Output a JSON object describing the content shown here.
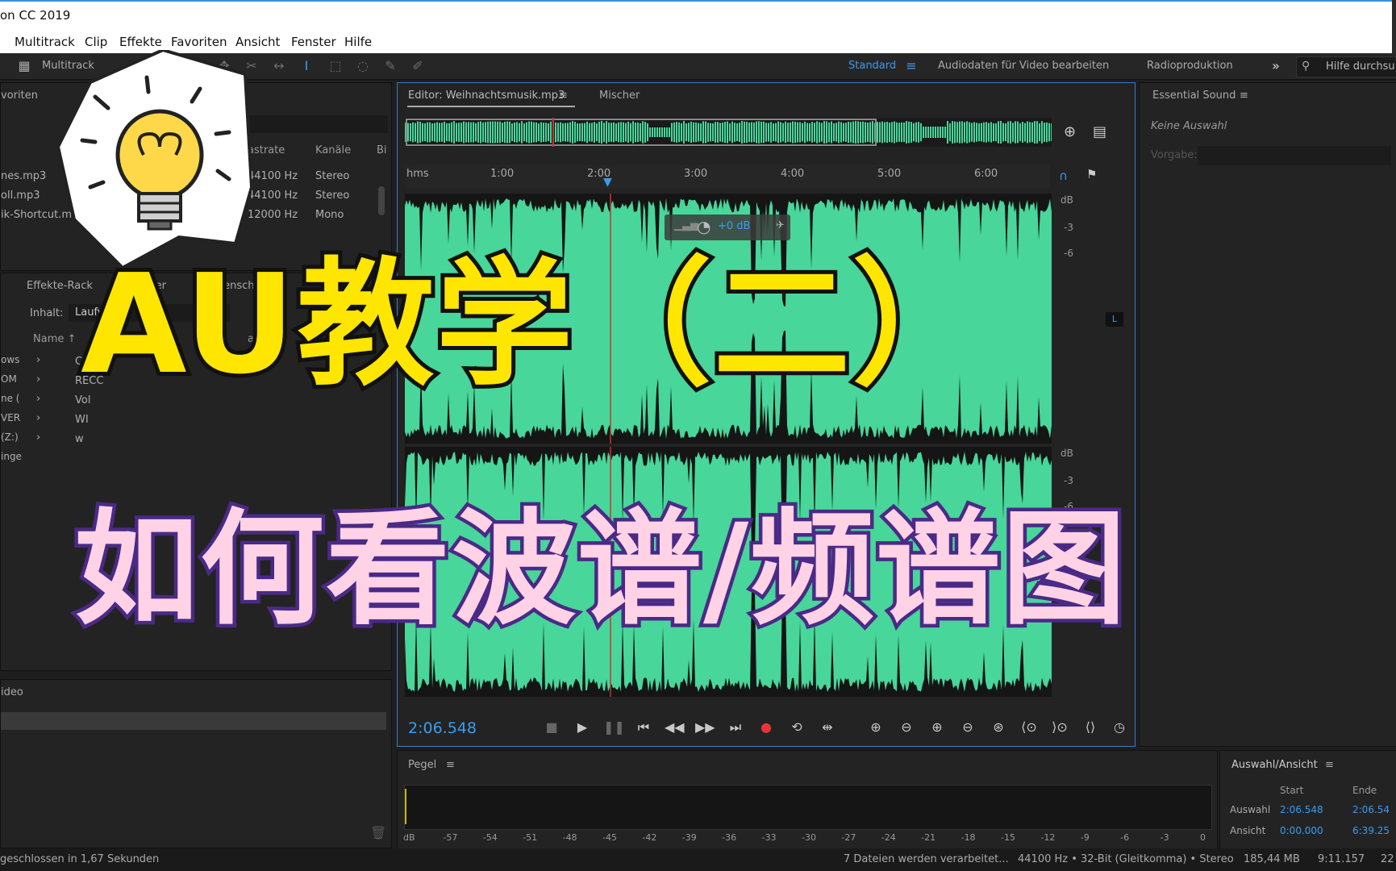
{
  "window": {
    "title": "on CC 2019"
  },
  "menu": [
    "Multitrack",
    "Clip",
    "Effekte",
    "Favoriten",
    "Ansicht",
    "Fenster",
    "Hilfe"
  ],
  "toolbar": {
    "multitrack_label": "Multitrack",
    "workspaces": [
      "Standard",
      "Audiodaten für Video bearbeiten",
      "Radioproduktion"
    ],
    "search_placeholder": "Hilfe durchsu"
  },
  "files_panel": {
    "title": "voriten",
    "columns": [
      "astrate",
      "Kanäle",
      "Bi"
    ],
    "rows": [
      {
        "name": "nes.mp3",
        "rate": "44100 Hz",
        "channels": "Stereo"
      },
      {
        "name": "oll.mp3",
        "rate": "44100 Hz",
        "channels": "Stereo"
      },
      {
        "name": "ik-Shortcut.m4a",
        "rate": "12000 Hz",
        "channels": "Mono"
      }
    ]
  },
  "media_panel": {
    "tabs": [
      "Effekte-Rack",
      "Marker",
      "Eigenschaften"
    ],
    "content_label": "Inhalt:",
    "content_value": "Laufwerke",
    "col_name": "Name ↑",
    "col_dauer": "auer",
    "left_labels": [
      "ows",
      "OM",
      "ne (",
      "VER",
      "(Z:)",
      "inge"
    ],
    "drives": [
      "CD-RC",
      "RECC",
      "Vol",
      "WI",
      "w"
    ]
  },
  "video_panel": {
    "title": "ideo"
  },
  "editor": {
    "tab_editor": "Editor: Weihnachtsmusik.mp3",
    "tab_mixer": "Mischer",
    "ruler_label": "hms",
    "ruler_ticks": [
      "1:00",
      "2:00",
      "3:00",
      "4:00",
      "5:00",
      "6:00"
    ],
    "gain_hud": "+0 dB",
    "db_upper": [
      "dB",
      "-3",
      "-6"
    ],
    "db_lower": [
      "dB",
      "-3",
      "-6"
    ],
    "channel_label": "L",
    "current_time": "2:06.548",
    "waveform_color": "#48d69a"
  },
  "essential_sound": {
    "title": "Essential Sound",
    "no_selection": "Keine Auswahl",
    "preset_label": "Vorgabe:"
  },
  "level_panel": {
    "title": "Pegel",
    "scale": [
      "dB",
      "-57",
      "-54",
      "-51",
      "-48",
      "-45",
      "-42",
      "-39",
      "-36",
      "-33",
      "-30",
      "-27",
      "-24",
      "-21",
      "-18",
      "-15",
      "-12",
      "-9",
      "-6",
      "-3",
      "0"
    ]
  },
  "selection_panel": {
    "title": "Auswahl/Ansicht",
    "col_start": "Start",
    "col_end": "Ende",
    "row_selection": {
      "label": "Auswahl",
      "start": "2:06.548",
      "end": "2:06.54"
    },
    "row_view": {
      "label": "Ansicht",
      "start": "0:00.000",
      "end": "6:39.25"
    }
  },
  "status": {
    "left": "geschlossen in 1,67 Sekunden",
    "processing": "7 Dateien werden verarbeitet...",
    "format": "44100 Hz • 32-Bit (Gleitkomma) • Stereo",
    "size": "185,44 MB",
    "duration": "9:11.157",
    "extra": "22"
  },
  "overlay": {
    "title": "AU教学（二）",
    "subtitle": "如何看波谱/频谱图",
    "title_color": "#ffe600",
    "subtitle_color": "#ffd2e6"
  }
}
